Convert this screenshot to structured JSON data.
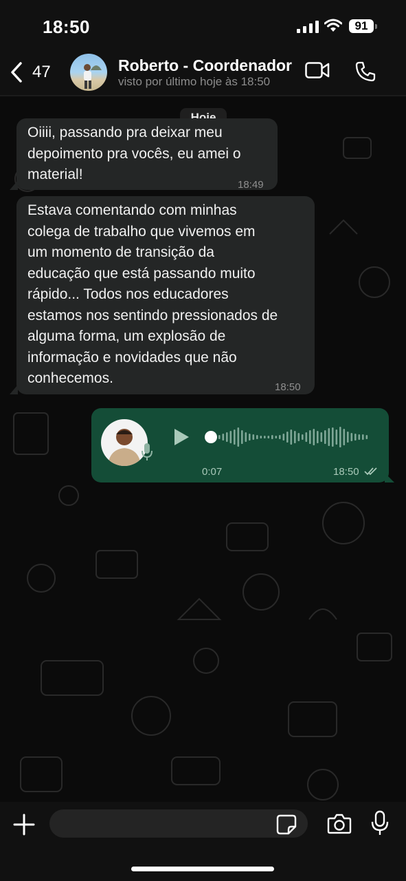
{
  "status_bar": {
    "time": "18:50",
    "battery": "91"
  },
  "header": {
    "unread_count": "47",
    "contact_name": "Roberto - Coordenador",
    "last_seen": "visto por último hoje às 18:50"
  },
  "chat": {
    "date_label": "Hoje",
    "messages": [
      {
        "lines": [
          "Oiiii, passando pra deixar meu",
          "depoimento pra vocês, eu amei o",
          "material!"
        ],
        "time": "18:49"
      },
      {
        "lines": [
          "Estava comentando com minhas",
          "colega de trabalho que vivemos em",
          "um momento de transição da",
          "educação que está passando muito",
          "rápido... Todos nos educadores",
          "estamos nos sentindo pressionados de",
          "alguma forma, um explosão de",
          "informação e novidades que não",
          "conhecemos."
        ],
        "time": "18:50"
      }
    ],
    "voice_message": {
      "duration": "0:07",
      "time": "18:50",
      "progress": 0
    }
  },
  "composer": {
    "placeholder": ""
  },
  "colors": {
    "outgoing_bubble": "#144d37",
    "incoming_bubble": "#242626",
    "background": "#0b0b0b"
  },
  "icons": [
    "chevron-left-icon",
    "video-call-icon",
    "phone-icon",
    "play-icon",
    "mic-icon",
    "plus-icon",
    "sticker-icon",
    "camera-icon",
    "double-check-icon"
  ]
}
